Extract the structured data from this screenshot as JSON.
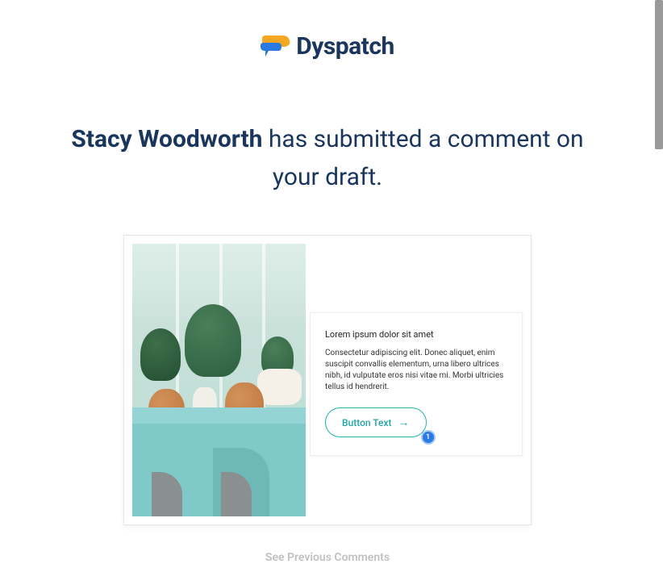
{
  "brand": {
    "name": "Dyspatch"
  },
  "headline": {
    "author": "Stacy Woodworth",
    "rest": " has submitted a comment on your draft."
  },
  "preview": {
    "title": "Lorem ipsum dolor sit amet",
    "body": "Consectetur adipiscing elit. Donec aliquet, enim suscipit convallis elementum, urna libero ultrices nibh, id vulputate eros nisi vitae mi. Morbi ultricies tellus id hendrerit.",
    "button_label": "Button Text",
    "comment_count": "1"
  },
  "footer": {
    "see_previous": "See Previous Comments"
  }
}
